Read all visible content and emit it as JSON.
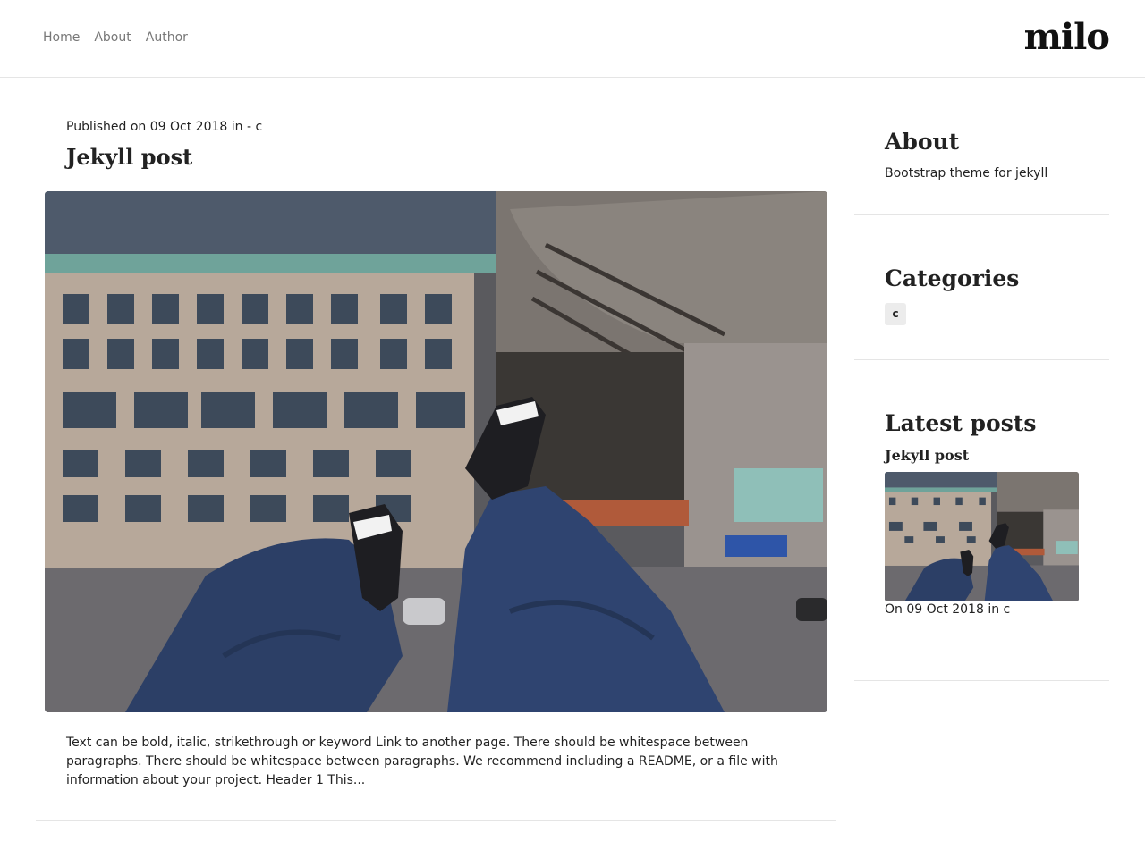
{
  "nav": {
    "items": [
      "Home",
      "About",
      "Author"
    ],
    "brand": "milo"
  },
  "post": {
    "meta": "Published on 09 Oct 2018 in - c",
    "title": "Jekyll post",
    "excerpt": "Text can be bold, italic, strikethrough or keyword Link to another page. There should be whitespace between paragraphs. There should be whitespace between paragraphs. We recommend including a README, or a file with information about your project. Header 1 This..."
  },
  "sidebar": {
    "about": {
      "heading": "About",
      "text": "Bootstrap theme for jekyll"
    },
    "categories": {
      "heading": "Categories",
      "items": [
        "c"
      ]
    },
    "latest": {
      "heading": "Latest posts",
      "posts": [
        {
          "title": "Jekyll post",
          "meta": "On 09 Oct 2018 in c"
        }
      ]
    }
  },
  "colors": {
    "text": "#222222",
    "nav": "#777777",
    "divider": "#e5e5e5",
    "badge": "#ececec"
  }
}
